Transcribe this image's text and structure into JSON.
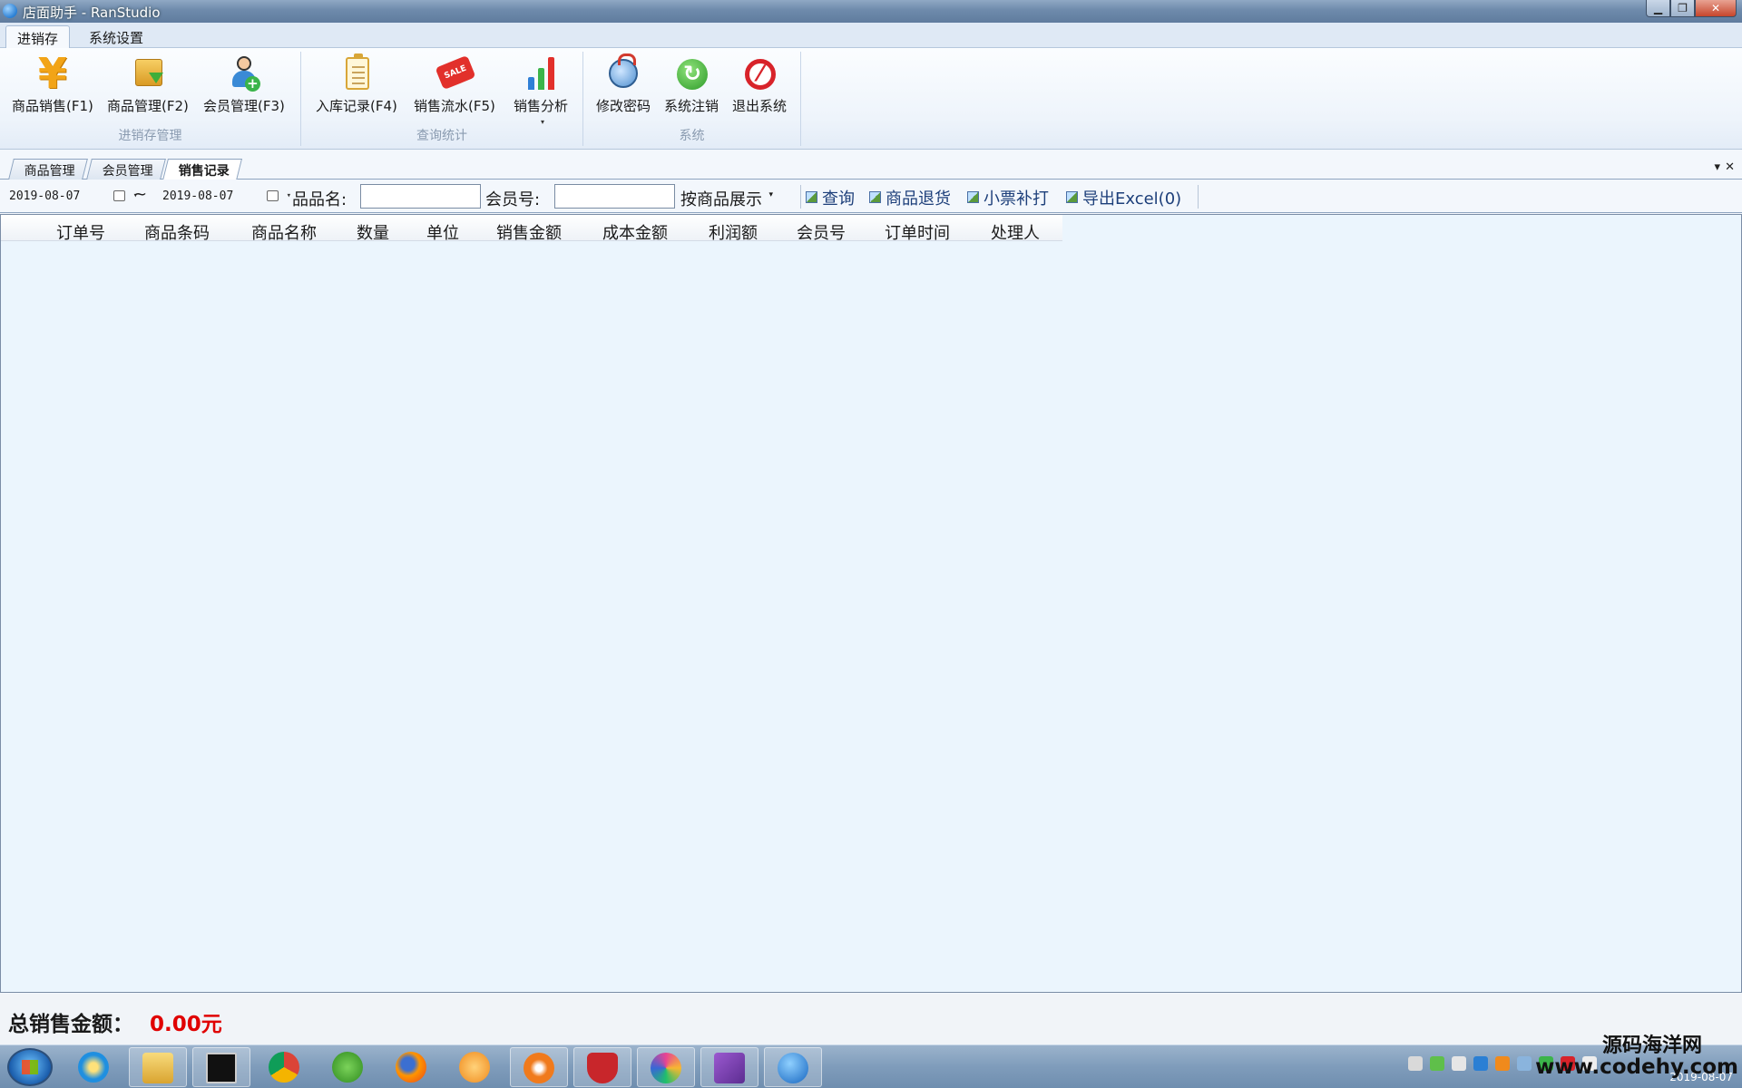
{
  "window": {
    "title": "店面助手 - RanStudio",
    "min": "▁",
    "max": "❐",
    "close": "✕"
  },
  "ribbon": {
    "tabs": [
      "进销存",
      "系统设置"
    ],
    "groups": [
      {
        "label": "进销存管理",
        "buttons": [
          "商品销售(F1)",
          "商品管理(F2)",
          "会员管理(F3)"
        ]
      },
      {
        "label": "查询统计",
        "buttons": [
          "入库记录(F4)",
          "销售流水(F5)",
          "销售分析"
        ]
      },
      {
        "label": "系统",
        "buttons": [
          "修改密码",
          "系统注销",
          "退出系统"
        ]
      }
    ],
    "sale_tag": "SALE",
    "yen_symbol": "¥",
    "dropdown_arrow": "▾"
  },
  "doc_tabs": [
    "商品管理",
    "会员管理",
    "销售记录"
  ],
  "doc_controls": {
    "menu": "▾",
    "close": "✕"
  },
  "query": {
    "date_from": "2019-08-07",
    "date_to": "2019-08-07",
    "range_sep": "~",
    "product_name_label": "品品名:",
    "product_name_value": "",
    "member_label": "会员号:",
    "member_value": "",
    "display_mode": "按商品展示",
    "actions": [
      "查询",
      "商品退货",
      "小票补打",
      "导出Excel(0)"
    ]
  },
  "grid": {
    "columns": [
      "订单号",
      "商品条码",
      "商品名称",
      "数量",
      "单位",
      "销售金额",
      "成本金额",
      "利润额",
      "会员号",
      "订单时间",
      "处理人"
    ],
    "rows": []
  },
  "footer": {
    "total_label": "总销售金额：",
    "total_value": "0.00元"
  },
  "taskbar": {
    "apps": [
      "internet-explorer",
      "file-explorer",
      "command-prompt",
      "chrome",
      "app-green",
      "firefox",
      "app-orange",
      "app-orange-2",
      "app-shield",
      "app-colorful",
      "visual-studio",
      "app-blue"
    ],
    "clock": "2019-08-07"
  },
  "watermark": {
    "line1": "源码海洋网",
    "line2": "www.codehy.com"
  },
  "colors": {
    "accent": "#1d3f7a",
    "total_value": "#e00000",
    "grid_bg": "#ebf5fd"
  }
}
